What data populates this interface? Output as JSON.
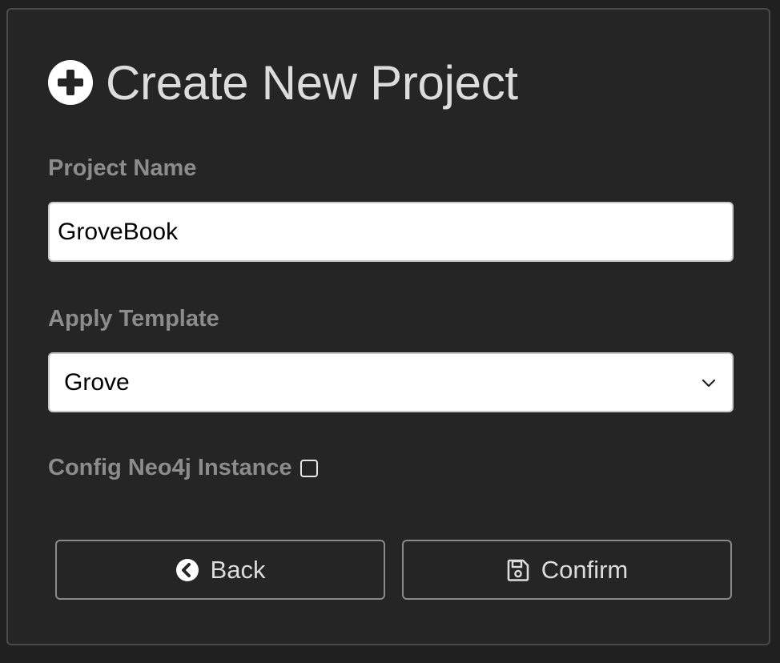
{
  "dialog": {
    "title": "Create New Project",
    "title_icon": "plus-circle-icon"
  },
  "project_name": {
    "label": "Project Name",
    "value": "GroveBook"
  },
  "template": {
    "label": "Apply Template",
    "selected": "Grove",
    "icon": "chevron-down-icon"
  },
  "neo4j": {
    "label": "Config Neo4j Instance",
    "checked": false
  },
  "buttons": {
    "back_label": "Back",
    "back_icon": "arrow-left-circle-icon",
    "confirm_label": "Confirm",
    "confirm_icon": "save-icon"
  },
  "colors": {
    "background": "#252525",
    "border": "#4a4a4a",
    "title_text": "#dcdcdc",
    "label_text": "#8c8c8c",
    "input_bg": "#ffffff"
  }
}
